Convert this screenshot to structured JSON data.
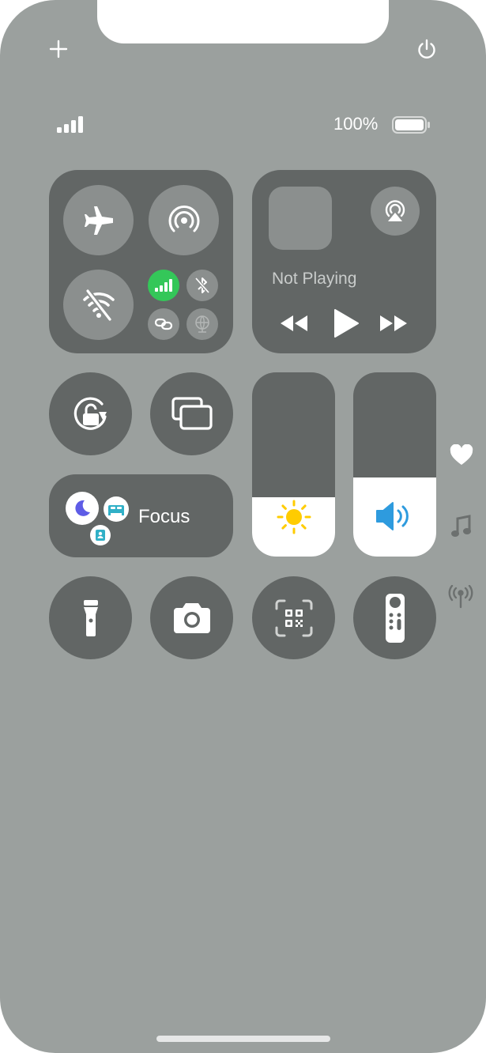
{
  "status": {
    "battery_text": "100%",
    "signal_bars": 4
  },
  "top_bar": {
    "add_icon": "plus-icon",
    "power_icon": "power-icon"
  },
  "connectivity": {
    "airplane_mode": {
      "icon": "airplane-icon",
      "on": false
    },
    "airdrop": {
      "icon": "airdrop-icon",
      "on": false
    },
    "wifi": {
      "icon": "wifi-off-icon",
      "on": false
    },
    "cellular": {
      "icon": "cellular-icon",
      "on": true,
      "color": "#34c759"
    },
    "bluetooth": {
      "icon": "bluetooth-off-icon",
      "on": false
    },
    "hotspot": {
      "icon": "link-icon",
      "on": false
    },
    "vpn": {
      "icon": "globe-icon",
      "on": false
    }
  },
  "now_playing": {
    "title": "Not Playing",
    "airplay_icon": "airplay-audio-icon",
    "controls": [
      "rewind-icon",
      "play-icon",
      "fast-forward-icon"
    ]
  },
  "controls": {
    "rotation_lock_icon": "rotation-lock-icon",
    "screen_mirroring_icon": "screen-mirroring-icon",
    "focus": {
      "label": "Focus",
      "icons": [
        "moon-icon",
        "bed-icon",
        "person-badge-icon"
      ],
      "moon_color": "#5e5ce6",
      "bed_color": "#30b0c7"
    },
    "brightness": {
      "level": 0.32,
      "icon": "sun-icon",
      "color": "#ffcc00"
    },
    "volume": {
      "level": 0.43,
      "icon": "speaker-icon",
      "color": "#2e9bde"
    }
  },
  "bottom_row": [
    "flashlight-icon",
    "camera-icon",
    "qr-code-scanner-icon",
    "apple-tv-remote-icon"
  ],
  "page_indicators": [
    "heart-icon",
    "music-note-icon",
    "antenna-icon"
  ]
}
